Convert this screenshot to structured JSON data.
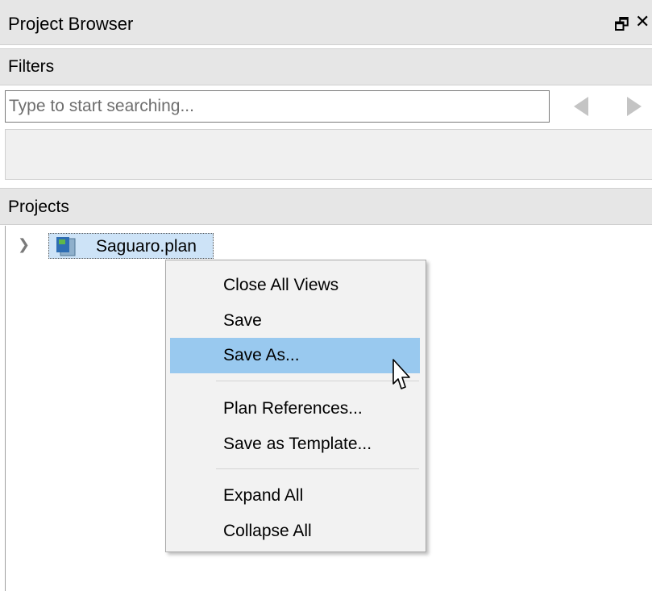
{
  "panel": {
    "title": "Project Browser",
    "float_icon": "restore-window-icon",
    "close_icon": "close-icon"
  },
  "filters": {
    "header": "Filters",
    "search_placeholder": "Type to start searching...",
    "search_value": "",
    "prev_icon": "triangle-left-icon",
    "next_icon": "triangle-right-icon"
  },
  "projects": {
    "header": "Projects",
    "items": [
      {
        "label": "Saguaro.plan",
        "icon": "plan-file-icon",
        "expanded": false,
        "selected": true
      }
    ]
  },
  "context_menu": {
    "items": [
      {
        "label": "Close All Views"
      },
      {
        "label": "Save"
      },
      {
        "label": "Save As...",
        "highlighted": true
      },
      {
        "label": "Plan References..."
      },
      {
        "label": "Save as Template..."
      },
      {
        "label": "Expand All"
      },
      {
        "label": "Collapse All"
      }
    ]
  },
  "colors": {
    "header_bg": "#e6e6e6",
    "menu_bg": "#f2f2f2",
    "menu_highlight": "#99c9ef",
    "selection_bg": "#cde3f7"
  }
}
